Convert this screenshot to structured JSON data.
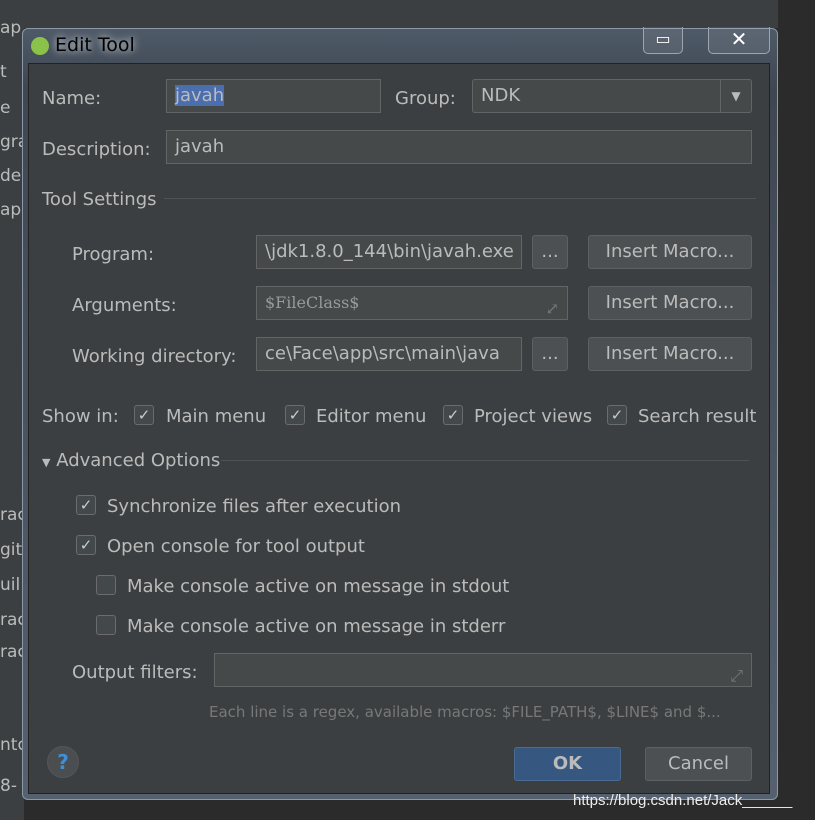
{
  "background": {
    "left_fragments": [
      "ap",
      "t",
      "e",
      "gra",
      "de",
      "app",
      "rac",
      "giti",
      "uil",
      "rac",
      "rac",
      "nto",
      "8-"
    ]
  },
  "dialog": {
    "title": "Edit Tool",
    "close_label": "✕",
    "restore_label": "▭"
  },
  "name": {
    "label": "Name:",
    "value": "javah"
  },
  "group": {
    "label": "Group:",
    "value": "NDK"
  },
  "description": {
    "label": "Description:",
    "value": "javah"
  },
  "tool_settings": {
    "heading": "Tool Settings",
    "program": {
      "label": "Program:",
      "value": "\\jdk1.8.0_144\\bin\\javah.exe",
      "browse": "...",
      "macro": "Insert Macro..."
    },
    "arguments": {
      "label": "Arguments:",
      "value": "$FileClass$",
      "macro": "Insert Macro..."
    },
    "working_dir": {
      "label": "Working directory:",
      "value": "ce\\Face\\app\\src\\main\\java",
      "browse": "...",
      "macro": "Insert Macro..."
    }
  },
  "show_in": {
    "label": "Show in:",
    "items": [
      {
        "label": "Main menu",
        "checked": true
      },
      {
        "label": "Editor menu",
        "checked": true
      },
      {
        "label": "Project views",
        "checked": true
      },
      {
        "label": "Search result",
        "checked": true
      }
    ]
  },
  "advanced": {
    "heading": "Advanced Options",
    "options": [
      {
        "label": "Synchronize files after execution",
        "checked": true
      },
      {
        "label": "Open console for tool output",
        "checked": true
      },
      {
        "label": "Make console active on message in stdout",
        "checked": false
      },
      {
        "label": "Make console active on message in stderr",
        "checked": false
      }
    ],
    "output_filters": {
      "label": "Output filters:",
      "value": "",
      "hint": "Each line is a regex, available macros: $FILE_PATH$, $LINE$ and $..."
    }
  },
  "buttons": {
    "help": "?",
    "ok": "OK",
    "cancel": "Cancel"
  },
  "watermark": "https://blog.csdn.net/Jack______",
  "colors": {
    "bg": "#3c3f41",
    "ok": "#365880",
    "selection": "#4b6eaf"
  }
}
